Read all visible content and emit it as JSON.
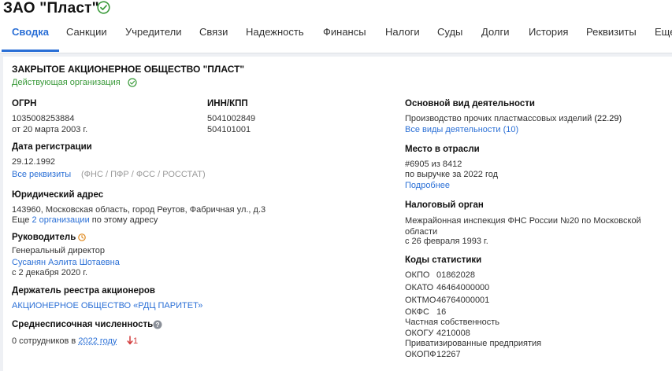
{
  "header": {
    "title": "ЗАО \"Пласт\"",
    "tabs": [
      "Сводка",
      "Санкции",
      "Учредители",
      "Связи",
      "Надежность",
      "Финансы",
      "Налоги",
      "Суды",
      "Долги",
      "История",
      "Реквизиты",
      "Еще"
    ]
  },
  "company": {
    "full_name": "ЗАКРЫТОЕ АКЦИОНЕРНОЕ ОБЩЕСТВО \"ПЛАСТ\"",
    "status": "Действующая организация"
  },
  "ogrn": {
    "label": "ОГРН",
    "value": "1035008253884",
    "date": "от 20 марта 2003 г."
  },
  "inn": {
    "label": "ИНН/КПП",
    "inn": "5041002849",
    "kpp": "504101001"
  },
  "registration": {
    "label": "Дата регистрации",
    "date": "29.12.1992",
    "all_link": "Все реквизиты",
    "sources": "(ФНС / ПФР / ФСС / РОССТАТ)"
  },
  "address": {
    "label": "Юридический адрес",
    "value": "143960, Московская область, город Реутов, Фабричная ул., д.3",
    "also_prefix": "Еще",
    "also_link": "2 организации",
    "also_suffix": "по этому адресу"
  },
  "director": {
    "label": "Руководитель",
    "position": "Генеральный директор",
    "name": "Сусанян Аэлита Шотаевна",
    "since": "с 2 декабря 2020 г."
  },
  "registry": {
    "label": "Держатель реестра акционеров",
    "value": "АКЦИОНЕРНОЕ ОБЩЕСТВО «РДЦ ПАРИТЕТ»"
  },
  "employees": {
    "label": "Среднесписочная численность",
    "prefix": "0 сотрудников в",
    "year_link": "2022 году",
    "delta": "1"
  },
  "activity": {
    "label": "Основной вид деятельности",
    "value": "Производство прочих пластмассовых изделий",
    "code": "(22.29)",
    "all_link": "Все виды деятельности (10)"
  },
  "rank": {
    "label": "Место в отрасли",
    "value": "#6905 из 8412",
    "basis": "по выручке за 2022 год",
    "more_link": "Подробнее"
  },
  "tax": {
    "label": "Налоговый орган",
    "line1": "Межрайонная инспекция ФНС России №20 по Московской",
    "line2": "области",
    "since": "с 26 февраля 1993 г."
  },
  "stats": {
    "label": "Коды статистики",
    "okpo_k": "ОКПО",
    "okpo_v": "01862028",
    "okato_k": "ОКАТО",
    "okato_v": "46464000000",
    "oktmo_k": "ОКТМО",
    "oktmo_v": "46764000001",
    "okfs_k": "ОКФС",
    "okfs_v": "16",
    "okfs_desc": "Частная собственность",
    "okogu_k": "ОКОГУ",
    "okogu_v": "4210008",
    "okogu_desc": "Приватизированные предприятия",
    "okopf_k": "ОКОПФ",
    "okopf_v": "12267"
  },
  "colors": {
    "accent": "#2a6fd6",
    "ok": "#3a9a3a",
    "down": "#d23b3b"
  }
}
